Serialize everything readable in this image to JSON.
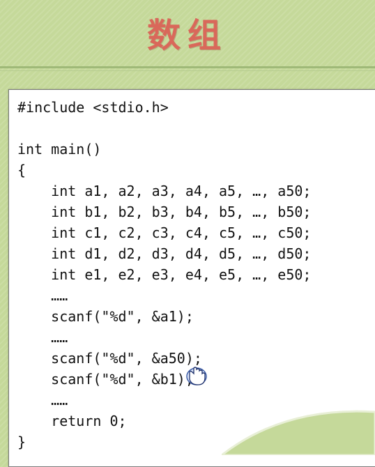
{
  "slide": {
    "title": "数组",
    "code_lines": [
      "#include <stdio.h>",
      "",
      "int main()",
      "{",
      "    int a1, a2, a3, a4, a5, …, a50;",
      "    int b1, b2, b3, b4, b5, …, b50;",
      "    int c1, c2, c3, c4, c5, …, c50;",
      "    int d1, d2, d3, d4, d5, …, d50;",
      "    int e1, e2, e3, e4, e5, …, e50;",
      "    ……",
      "    scanf(\"%d\", &a1);",
      "    ……",
      "    scanf(\"%d\", &a50);",
      "    scanf(\"%d\", &b1);",
      "    ……",
      "    return 0;",
      "}"
    ]
  },
  "colors": {
    "background": "#c5d99a",
    "title": "#d9685a",
    "code_text": "#111111"
  },
  "icons": {
    "cursor": "hand-pointer-icon"
  }
}
